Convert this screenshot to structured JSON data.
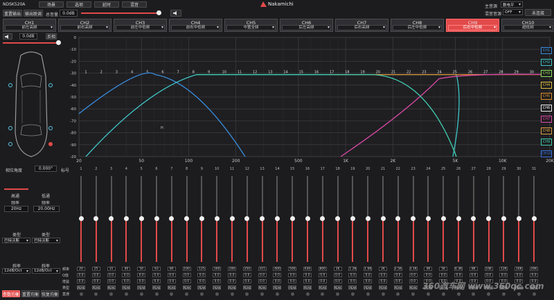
{
  "model": "NDSK520A",
  "top_tabs": [
    "场景",
    "选项",
    "延时",
    "混音"
  ],
  "brand": "Nakamichi",
  "main_source_label": "主音源",
  "main_source_value": "数电平",
  "mix_source_label": "混音音源",
  "mix_source_value": "OFF",
  "connect_label": "未连接",
  "reset_output": "重置输出",
  "output_link": "输出联调",
  "total_volume_label": "总音量",
  "total_volume_value": "0.0dB",
  "channel_volume_value": "0.0dB",
  "anti_phase": "反相",
  "channels": [
    {
      "name": "CH1",
      "sub": "前左高频"
    },
    {
      "name": "CH2",
      "sub": "前右高频"
    },
    {
      "name": "CH3",
      "sub": "前左中低频"
    },
    {
      "name": "CH4",
      "sub": "前右中低频"
    },
    {
      "name": "CH5",
      "sub": "中置全频"
    },
    {
      "name": "CH6",
      "sub": "后左高频"
    },
    {
      "name": "CH7",
      "sub": "后右高频"
    },
    {
      "name": "CH8",
      "sub": "后左中低频"
    },
    {
      "name": "CH9",
      "sub": "后右中低频"
    },
    {
      "name": "CH10",
      "sub": "超低频"
    }
  ],
  "active_channel": 8,
  "legend": [
    "CH1",
    "CH2",
    "CH3",
    "CH4",
    "CH5",
    "CH6",
    "CH7",
    "CH8",
    "CH9",
    "CH10"
  ],
  "colors": {
    "accent": "#e34a4a",
    "ch1": "#3a8fe0",
    "ch2": "#3fc8c8",
    "ch3": "#8fe05a",
    "ch4": "#e0c040",
    "ch5": "#e09030",
    "ch6": "#f0f0f0",
    "ch7": "#e04aa8",
    "ch8": "#e0a040",
    "ch9": "#40d0b0",
    "ch10": "#3a70e0"
  },
  "chart_data": {
    "type": "line",
    "x_ticks": [
      "20",
      "50",
      "100",
      "200",
      "500",
      "1K",
      "2K",
      "5K",
      "10K",
      "20K"
    ],
    "y_ticks": [
      "0",
      "-10",
      "-20",
      "-30",
      "-40",
      "-50",
      "-60",
      "-70",
      "-80",
      "-90",
      "-20"
    ],
    "band_numbers": [
      "1",
      "2",
      "3",
      "4",
      "5",
      "6",
      "7",
      "8",
      "9",
      "10",
      "11",
      "12",
      "13",
      "14",
      "15",
      "16",
      "17",
      "18",
      "19",
      "20",
      "21",
      "22",
      "23",
      "24",
      "25",
      "26",
      "27",
      "28",
      "29",
      "30",
      "31"
    ],
    "marker_label": "H",
    "series": [
      {
        "color": "#3a8fe0"
      },
      {
        "color": "#3fc8c8"
      },
      {
        "color": "#e09030"
      },
      {
        "color": "#e04aa8"
      },
      {
        "color": "#40d0b0"
      }
    ]
  },
  "angle_label": "相位角度",
  "angle_value": "0.000°",
  "band_label": "标号",
  "highpass_label": "高通",
  "lowpass_label": "低通",
  "freq_label": "频率",
  "highpass_freq": "20Hz",
  "lowpass_freq": "20.00Hz",
  "type_label": "类型",
  "hp_type": "巴特沃斯",
  "lp_type": "巴特沃斯",
  "slope_label": "斜率",
  "hp_slope": "12dB/Oct",
  "lp_slope": "12dB/Oct",
  "row_labels": [
    "频率",
    "Q值",
    "增益",
    "类型",
    "直通"
  ],
  "eq_freq_values": [
    "20",
    "25",
    "31",
    "40",
    "50",
    "63",
    "80",
    "100",
    "125",
    "160",
    "200",
    "250",
    "315",
    "400",
    "500",
    "630",
    "800",
    "1K",
    "1.2K",
    "1.6K",
    "2K",
    "2.5K",
    "3.1K",
    "4K",
    "5K",
    "6.3K",
    "8K",
    "10K",
    "12K",
    "16K",
    "20K"
  ],
  "q_value": "0.0",
  "gain_value": "0.0",
  "peak_label": "PEAK",
  "bottom_buttons": [
    "参数均衡",
    "重置均衡",
    "恢复均衡"
  ],
  "watermark": "360汽车网 www.360qc.com"
}
